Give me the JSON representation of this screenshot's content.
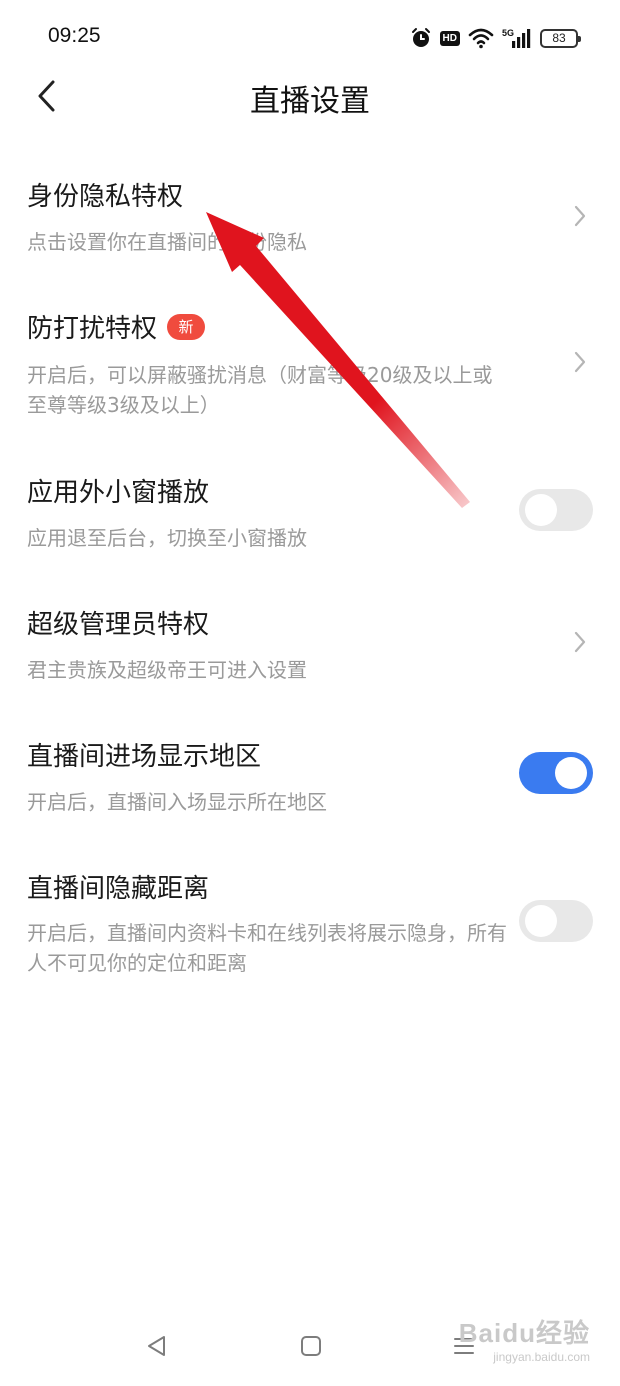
{
  "status_bar": {
    "time": "09:25",
    "hd_label": "HD",
    "network_label": "5G",
    "battery": "83",
    "icons": [
      "alarm-icon",
      "hd-icon",
      "wifi-icon",
      "signal-5g-icon",
      "battery-icon"
    ]
  },
  "header": {
    "title": "直播设置",
    "back_icon": "back-arrow-icon"
  },
  "settings": [
    {
      "title": "身份隐私特权",
      "description": "点击设置你在直播间的身份隐私",
      "control": "chevron"
    },
    {
      "title": "防打扰特权",
      "badge": "新",
      "description": "开启后，可以屏蔽骚扰消息（财富等级20级及以上或至尊等级3级及以上）",
      "control": "chevron"
    },
    {
      "title": "应用外小窗播放",
      "description": "应用退至后台，切换至小窗播放",
      "control": "toggle",
      "enabled": false
    },
    {
      "title": "超级管理员特权",
      "description": "君主贵族及超级帝王可进入设置",
      "control": "chevron"
    },
    {
      "title": "直播间进场显示地区",
      "description": "开启后，直播间入场显示所在地区",
      "control": "toggle",
      "enabled": true
    },
    {
      "title": "直播间隐藏距离",
      "description": "开启后，直播间内资料卡和在线列表将展示隐身，所有人不可见你的定位和距离",
      "control": "toggle",
      "enabled": false
    }
  ],
  "colors": {
    "toggle_on": "#3a7bf0",
    "toggle_off": "#e8e8e8",
    "badge": "#f04b3e",
    "annotation_arrow": "#e0141e"
  },
  "system_nav": {
    "icons": [
      "back-triangle-icon",
      "home-square-icon",
      "menu-lines-icon"
    ]
  },
  "watermark": {
    "main": "Baidu经验",
    "sub": "jingyan.baidu.com"
  }
}
